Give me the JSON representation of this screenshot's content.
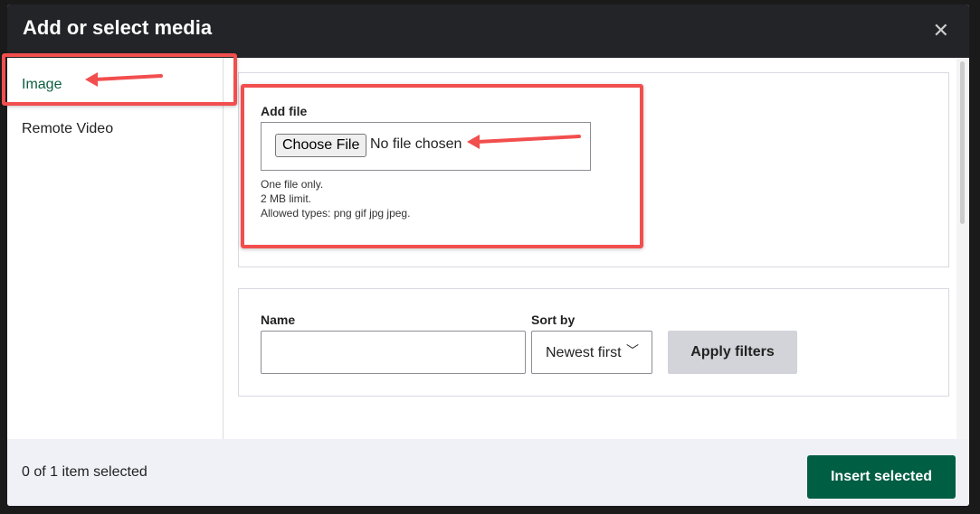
{
  "dialog": {
    "title": "Add or select media",
    "close_icon": "close-icon"
  },
  "sidebar": {
    "items": [
      {
        "label": "Image",
        "active": true
      },
      {
        "label": "Remote Video",
        "active": false
      }
    ]
  },
  "upload": {
    "label": "Add file",
    "choose_button": "Choose File",
    "file_status": "No file chosen",
    "help": [
      "One file only.",
      "2 MB limit.",
      "Allowed types: png gif jpg jpeg."
    ]
  },
  "filters": {
    "name_label": "Name",
    "name_value": "",
    "sort_label": "Sort by",
    "sort_value": "Newest first",
    "apply_label": "Apply filters"
  },
  "footer": {
    "selection_count": "0 of 1 item selected",
    "insert_label": "Insert selected"
  },
  "colors": {
    "accent": "#005e43",
    "annotation": "#f24e4e",
    "header": "#232428"
  }
}
